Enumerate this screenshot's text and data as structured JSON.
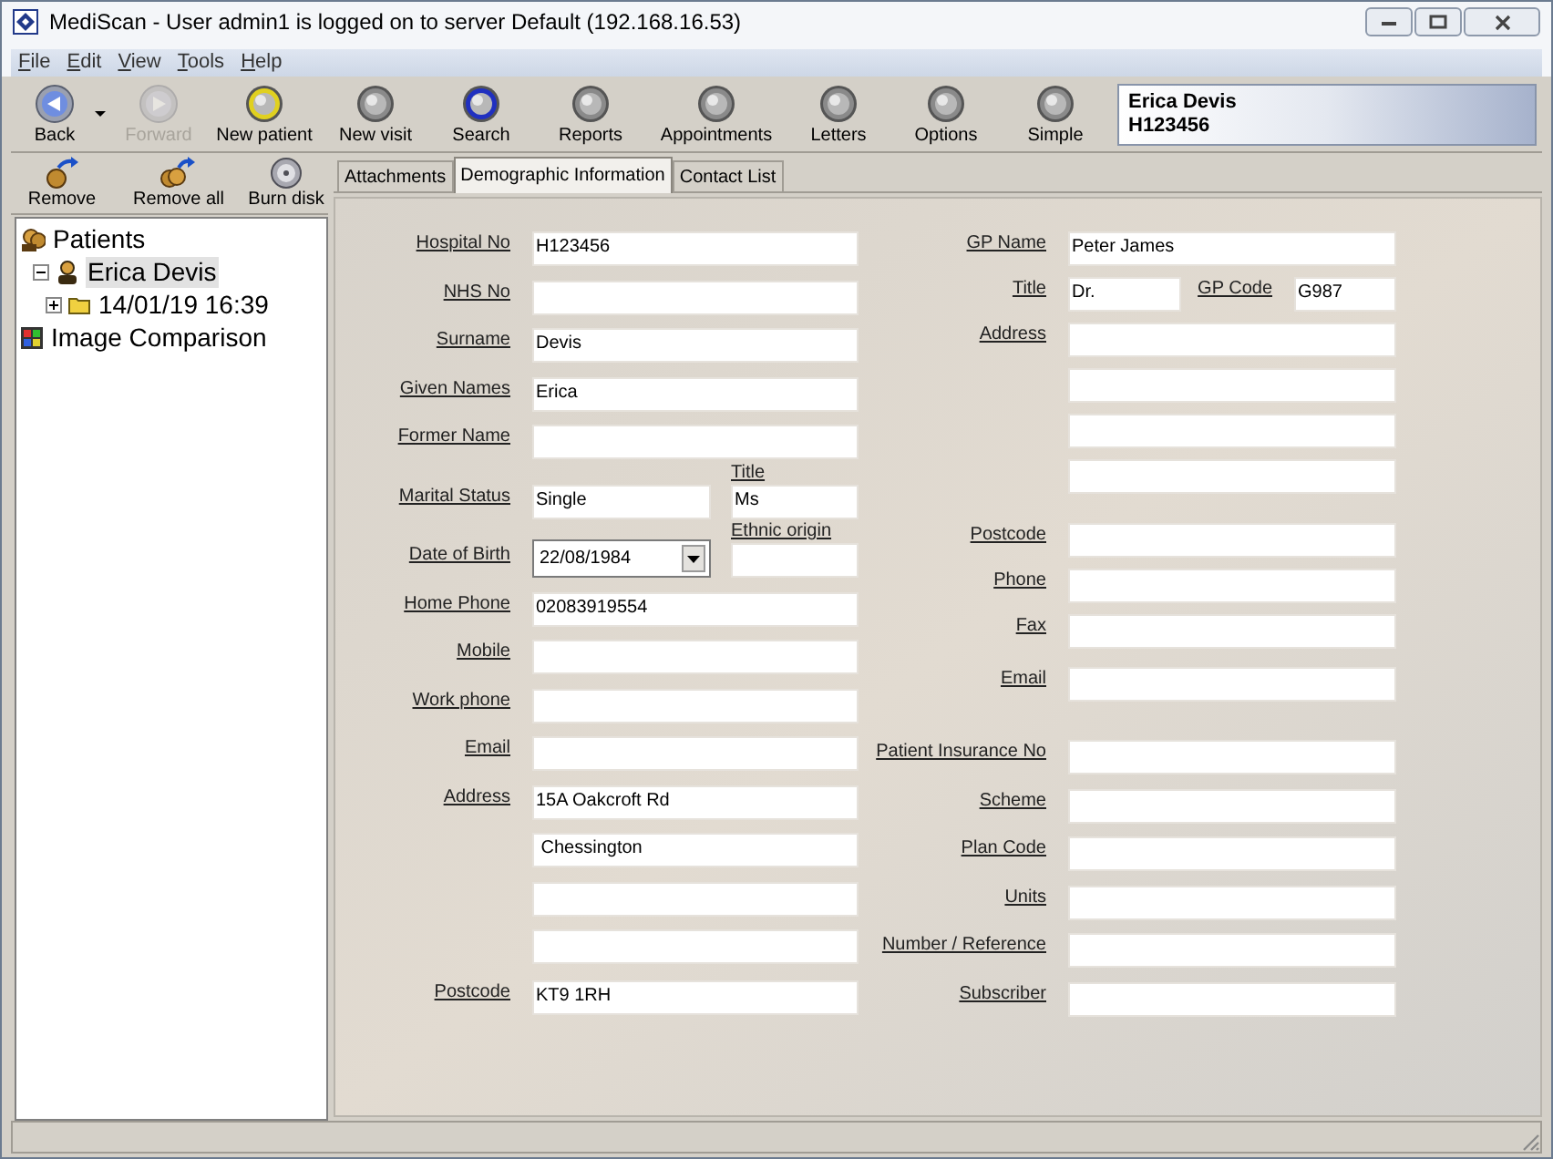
{
  "window": {
    "title": "MediScan - User admin1 is logged on to server Default (192.168.16.53)"
  },
  "menu": [
    {
      "label": "File"
    },
    {
      "label": "Edit"
    },
    {
      "label": "View"
    },
    {
      "label": "Tools"
    },
    {
      "label": "Help"
    }
  ],
  "toolbar": [
    {
      "label": "Back",
      "kind": "back",
      "disabled": false
    },
    {
      "kind": "dropdown",
      "disabled": false
    },
    {
      "label": "Forward",
      "kind": "forward",
      "disabled": true
    },
    {
      "label": "New patient",
      "kind": "circle",
      "color": "#e0d020",
      "disabled": false
    },
    {
      "label": "New visit",
      "kind": "circle",
      "color": "#8a8a8a",
      "disabled": false
    },
    {
      "label": "Search",
      "kind": "circle",
      "color": "#2030c0",
      "disabled": false
    },
    {
      "label": "Reports",
      "kind": "circle",
      "color": "#8a8a8a",
      "disabled": false
    },
    {
      "label": "Appointments",
      "kind": "circle",
      "color": "#8a8a8a",
      "disabled": false
    },
    {
      "label": "Letters",
      "kind": "circle",
      "color": "#8a8a8a",
      "disabled": false
    },
    {
      "label": "Options",
      "kind": "circle",
      "color": "#8a8a8a",
      "disabled": false
    },
    {
      "label": "Simple",
      "kind": "circle",
      "color": "#8a8a8a",
      "disabled": false
    }
  ],
  "patient_card": {
    "name": "Erica Devis",
    "hospital_no": "H123456"
  },
  "side_toolbar": [
    {
      "label": "Remove",
      "kind": "remove"
    },
    {
      "label": "Remove all",
      "kind": "remove_all"
    },
    {
      "label": "Burn disk",
      "kind": "disk"
    }
  ],
  "tree": [
    {
      "label": "Patients",
      "kind": "patients",
      "selected": false,
      "children": [
        {
          "label": "Erica Devis",
          "kind": "patient",
          "expanded": true,
          "selected": true,
          "children": [
            {
              "label": "14/01/19 16:39",
              "kind": "folder",
              "expanded": false,
              "selected": false
            }
          ]
        }
      ]
    },
    {
      "label": "Image Comparison",
      "kind": "comparison",
      "selected": false
    }
  ],
  "tabs": [
    {
      "label": "Attachments",
      "selected": false
    },
    {
      "label": "Demographic Information",
      "selected": true
    },
    {
      "label": "Contact List",
      "selected": false
    }
  ],
  "left_fields": [
    {
      "kind": "text",
      "label": "Hospital No",
      "value": "H123456"
    },
    {
      "kind": "text",
      "label": "NHS No"
    },
    {
      "kind": "text",
      "label": "Surname",
      "value": "Devis"
    },
    {
      "kind": "text",
      "label": "Given Names",
      "value": "Erica"
    },
    {
      "kind": "text",
      "label": "Former Name"
    },
    {
      "kind": "pair",
      "label": "Marital Status",
      "value": "Single",
      "side_label": "Title",
      "side_value": "Ms"
    },
    {
      "kind": "date",
      "label": "Date of Birth",
      "value": "22/08/1984",
      "side_label": "Ethnic origin"
    },
    {
      "kind": "text",
      "label": "Home Phone",
      "value": "02083919554"
    },
    {
      "kind": "text",
      "label": "Mobile"
    },
    {
      "kind": "text",
      "label": "Work phone"
    },
    {
      "kind": "text",
      "label": "Email"
    },
    {
      "kind": "text",
      "label": "Address",
      "value": "15A Oakcroft Rd"
    },
    {
      "kind": "text",
      "value": " Chessington"
    },
    {
      "kind": "text"
    },
    {
      "kind": "text"
    },
    {
      "kind": "text",
      "label": "Postcode",
      "value": "KT9 1RH"
    }
  ],
  "right_fields": [
    {
      "kind": "text",
      "label": "GP Name",
      "value": "Peter James"
    },
    {
      "kind": "inline_pair",
      "label": "Title",
      "value": "Dr.",
      "side_label": "GP Code",
      "side_value": "G987"
    },
    {
      "kind": "text",
      "label": "Address"
    },
    {
      "kind": "text"
    },
    {
      "kind": "text"
    },
    {
      "kind": "text"
    },
    {
      "kind": "text",
      "label": "Postcode"
    },
    {
      "kind": "text",
      "label": "Phone"
    },
    {
      "kind": "text",
      "label": "Fax"
    },
    {
      "kind": "text",
      "label": "Email"
    },
    {
      "kind": "text",
      "label": "Patient Insurance No"
    },
    {
      "kind": "text",
      "label": "Scheme"
    },
    {
      "kind": "text",
      "label": "Plan Code"
    },
    {
      "kind": "text",
      "label": "Units"
    },
    {
      "kind": "text",
      "label": "Number / Reference"
    },
    {
      "kind": "text",
      "label": "Subscriber"
    }
  ]
}
